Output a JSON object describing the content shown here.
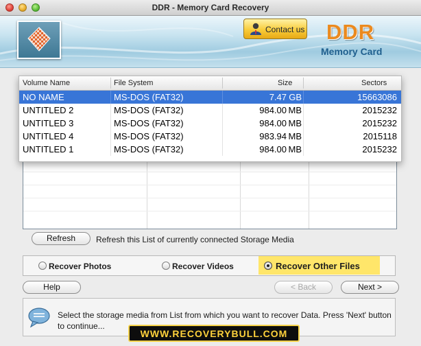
{
  "window": {
    "title": "DDR - Memory Card Recovery"
  },
  "header": {
    "contact_label": "Contact us",
    "brand": "DDR",
    "brand_sub": "Memory Card",
    "logo_icon": "checker-globe-icon",
    "contact_icon": "person-icon"
  },
  "media_table": {
    "columns": [
      "Volume Name",
      "File System",
      "Size",
      "Sectors"
    ],
    "selected_index": 0,
    "rows": [
      {
        "volume": "NO NAME",
        "fs": "MS-DOS (FAT32)",
        "size": "7.47",
        "unit": "GB",
        "sectors": "15663086"
      },
      {
        "volume": "UNTITLED 2",
        "fs": "MS-DOS (FAT32)",
        "size": "984.00",
        "unit": "MB",
        "sectors": "2015232"
      },
      {
        "volume": "UNTITLED 3",
        "fs": "MS-DOS (FAT32)",
        "size": "984.00",
        "unit": "MB",
        "sectors": "2015232"
      },
      {
        "volume": "UNTITLED 4",
        "fs": "MS-DOS (FAT32)",
        "size": "983.94",
        "unit": "MB",
        "sectors": "2015118"
      },
      {
        "volume": "UNTITLED 1",
        "fs": "MS-DOS (FAT32)",
        "size": "984.00",
        "unit": "MB",
        "sectors": "2015232"
      }
    ]
  },
  "refresh": {
    "label": "Refresh",
    "description": "Refresh this List of currently connected Storage Media"
  },
  "options": {
    "photos": "Recover Photos",
    "videos": "Recover Videos",
    "other": "Recover Other Files",
    "selected": "other",
    "highlight_color": "#ffe66a"
  },
  "nav": {
    "help": "Help",
    "back": "< Back",
    "next": "Next >"
  },
  "info": {
    "text": "Select the storage media from List from which you want to recover Data. Press 'Next' button to continue...",
    "icon": "speech-bubble-icon"
  },
  "footer": {
    "banner": "WWW.RECOVERYBULL.COM"
  },
  "colors": {
    "selection": "#3875d7",
    "brand": "#eb8a1f",
    "contact_button": "#f8cc3a"
  }
}
